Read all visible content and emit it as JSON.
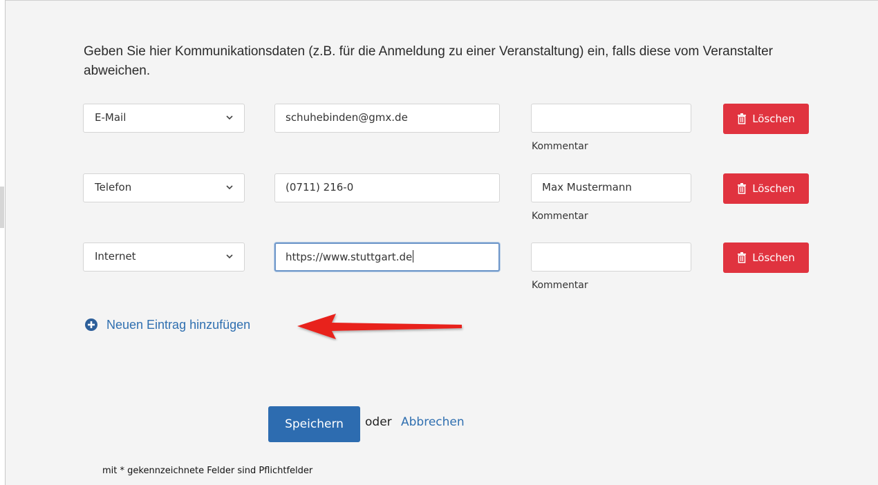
{
  "intro_text": "Geben Sie hier Kommunikationsdaten (z.B. für die Anmeldung zu einer Veranstaltung) ein, falls diese vom Veranstalter abweichen.",
  "rows": [
    {
      "type": "E-Mail",
      "value": "schuhebinden@gmx.de",
      "comment": "",
      "comment_label": "Kommentar",
      "delete_label": "Löschen"
    },
    {
      "type": "Telefon",
      "value": "(0711) 216-0",
      "comment": "Max Mustermann",
      "comment_label": "Kommentar",
      "delete_label": "Löschen"
    },
    {
      "type": "Internet",
      "value": "https://www.stuttgart.de",
      "comment": "",
      "comment_label": "Kommentar",
      "delete_label": "Löschen"
    }
  ],
  "add_entry_label": "Neuen Eintrag hinzufügen",
  "save_label": "Speichern",
  "or_label": "oder",
  "cancel_label": "Abbrechen",
  "required_note": "mit * gekennzeichnete Felder sind Pflichtfelder",
  "colors": {
    "delete": "#e0333f",
    "primary": "#2d6cb0",
    "link": "#2f6fb0",
    "annotation_arrow": "#e8201c"
  },
  "icons": {
    "select_chevron": "chevron-down-icon",
    "delete": "trash-icon",
    "add": "plus-circle-icon",
    "annotation": "red-arrow-annotation"
  }
}
